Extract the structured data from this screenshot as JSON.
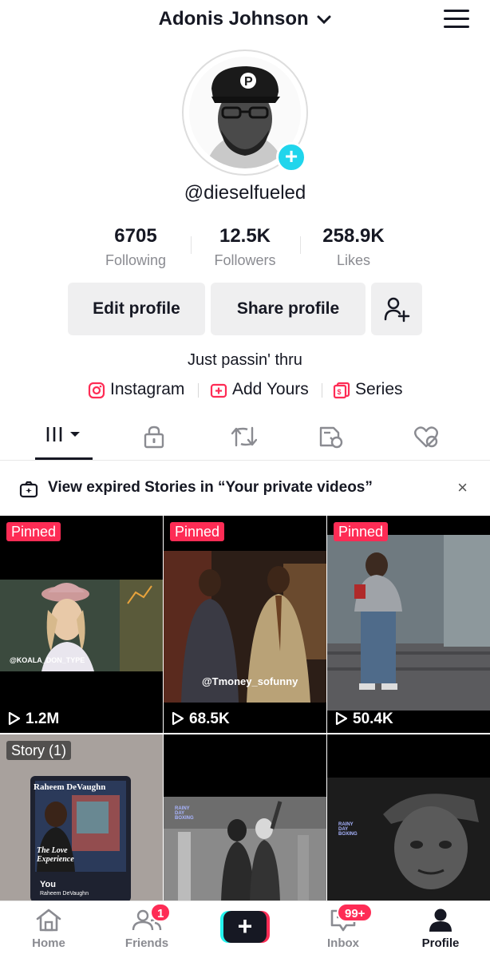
{
  "header": {
    "title": "Adonis Johnson"
  },
  "profile": {
    "handle": "@dieselfueled",
    "stats": [
      {
        "value": "6705",
        "label": "Following"
      },
      {
        "value": "12.5K",
        "label": "Followers"
      },
      {
        "value": "258.9K",
        "label": "Likes"
      }
    ],
    "buttons": {
      "edit": "Edit profile",
      "share": "Share profile"
    },
    "bio": "Just passin' thru",
    "links": [
      {
        "label": "Instagram",
        "icon": "instagram-icon"
      },
      {
        "label": "Add Yours",
        "icon": "add-yours-icon"
      },
      {
        "label": "Series",
        "icon": "series-icon"
      }
    ]
  },
  "tabs": [
    {
      "icon": "videos-grid-icon",
      "active": true
    },
    {
      "icon": "lock-icon"
    },
    {
      "icon": "repost-icon"
    },
    {
      "icon": "favorites-icon"
    },
    {
      "icon": "liked-icon"
    }
  ],
  "notice": {
    "text": "View expired Stories in “Your private videos”",
    "close": "×"
  },
  "videos": [
    {
      "badge": "Pinned",
      "views": "1.2M",
      "watermark": "@KOALA_DON_TYPE"
    },
    {
      "badge": "Pinned",
      "views": "68.5K",
      "watermark": "@Tmoney_sofunny"
    },
    {
      "badge": "Pinned",
      "views": "50.4K"
    },
    {
      "badge": "Story (1)",
      "album_artist": "Raheem DeVaughn",
      "album_title": "The Love Experience",
      "song": "You",
      "song_artist": "Raheem DeVaughn"
    },
    {
      "watermark": "RAINY DAY BOXING"
    },
    {
      "watermark": "RAINY DAY BOXING"
    }
  ],
  "bottom_nav": {
    "home": "Home",
    "friends": "Friends",
    "friends_badge": "1",
    "inbox": "Inbox",
    "inbox_badge": "99+",
    "profile": "Profile",
    "create": "+"
  },
  "colors": {
    "accent": "#fe2c55",
    "cyan": "#25f4ee",
    "text": "#161823",
    "muted": "#8a8b91"
  }
}
